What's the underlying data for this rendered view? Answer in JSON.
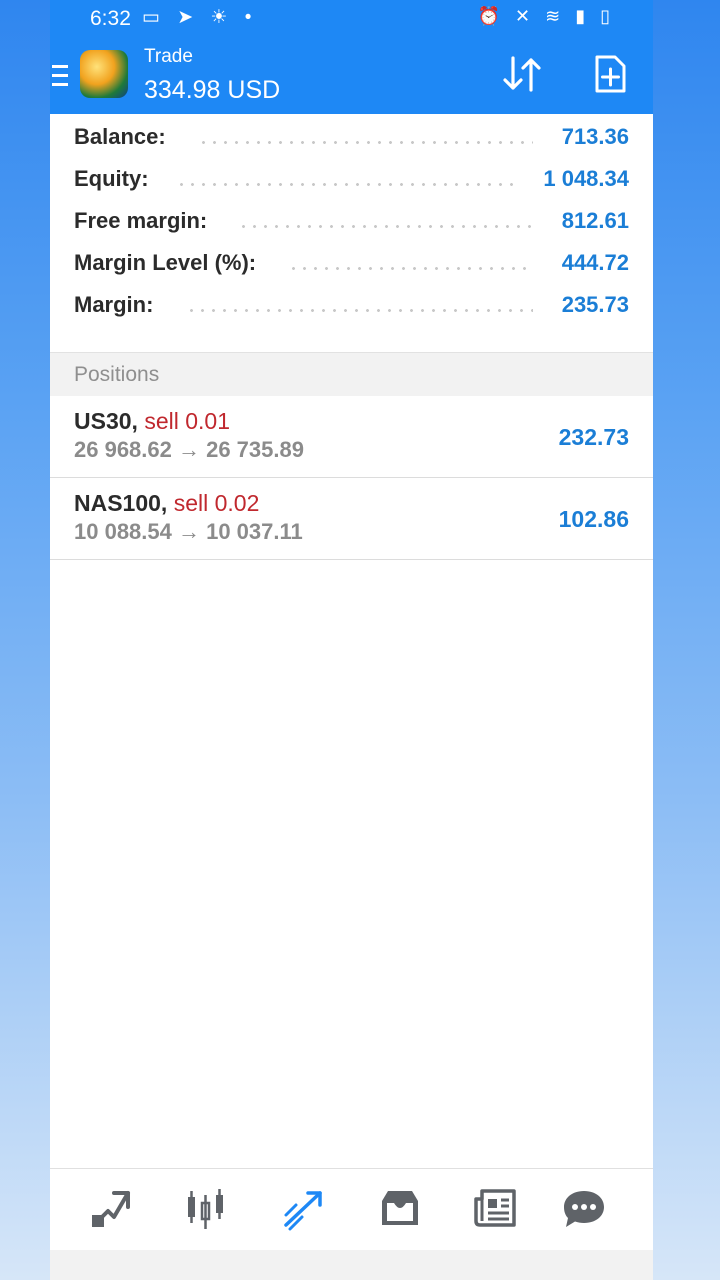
{
  "status_bar": {
    "time": "6:32",
    "left_icons": "▭ ➤ ☀ •",
    "right_icons": "⏰ ✕ ≋ ▮ ▯"
  },
  "app_bar": {
    "title": "Trade",
    "balance": "334.98 USD"
  },
  "account": [
    {
      "label": "Balance:",
      "value": "713.36"
    },
    {
      "label": "Equity:",
      "value": "1 048.34"
    },
    {
      "label": "Free margin:",
      "value": "812.61"
    },
    {
      "label": "Margin Level (%):",
      "value": "444.72"
    },
    {
      "label": "Margin:",
      "value": "235.73"
    }
  ],
  "positions_header": "Positions",
  "positions": [
    {
      "symbol": "US30,",
      "side": "sell 0.01",
      "prices": "26 968.62 → 26 735.89",
      "profit": "232.73"
    },
    {
      "symbol": "NAS100,",
      "side": "sell 0.02",
      "prices": "10 088.54 → 10 037.11",
      "profit": "102.86"
    }
  ],
  "bottom_nav": [
    "quotes-icon",
    "charts-icon",
    "trade-icon",
    "history-icon",
    "news-icon",
    "messages-icon"
  ],
  "colors": {
    "accent": "#1e88f5",
    "value_blue": "#1b7ed6",
    "sell_red": "#c0282e",
    "active_nav": "#1e88f5",
    "inactive_nav": "#5f6368"
  }
}
